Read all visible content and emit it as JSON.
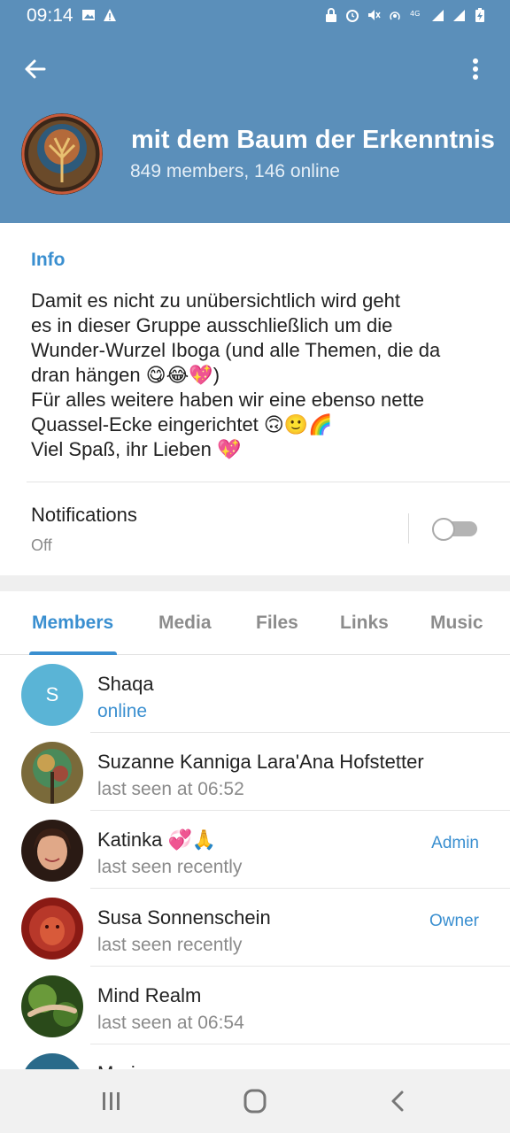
{
  "status_bar": {
    "time": "09:14",
    "left_icons": [
      "image-icon",
      "warning-icon"
    ],
    "right_icons": [
      "lock-icon",
      "alarm-icon",
      "mute-icon",
      "hotspot-icon",
      "4g-icon",
      "signal-icon",
      "signal-roaming-icon",
      "battery-charging-icon"
    ]
  },
  "header": {
    "title": "mit dem Baum der Erkenntnis",
    "subtitle": "849 members, 146 online",
    "back_icon": "arrow-left-icon",
    "menu_icon": "more-vertical-icon",
    "color": "#5b8fba"
  },
  "info": {
    "label": "Info",
    "text": "Damit es nicht zu unübersichtlich wird geht\nes in dieser Gruppe ausschließlich um die\nWunder-Wurzel Iboga (und alle Themen, die da\ndran hängen 😋😂💖)\nFür alles weitere haben wir eine ebenso nette\nQuassel-Ecke eingerichtet 🙃🙂🌈\nViel Spaß, ihr Lieben 💖"
  },
  "notifications": {
    "label": "Notifications",
    "value": "Off",
    "enabled": false
  },
  "tabs": [
    {
      "label": "Members",
      "active": true
    },
    {
      "label": "Media",
      "active": false
    },
    {
      "label": "Files",
      "active": false
    },
    {
      "label": "Links",
      "active": false
    },
    {
      "label": "Music",
      "active": false
    }
  ],
  "members": [
    {
      "name": "Shaqa",
      "status": "online",
      "role": "",
      "avatar_letter": "S",
      "avatar_color": "#5ab4d6"
    },
    {
      "name": "Suzanne Kanniga Lara'Ana Hofstetter",
      "status": "last seen at 06:52",
      "role": "",
      "avatar_letter": "",
      "avatar_color": "#8a7a4a"
    },
    {
      "name": "Katinka 💞🙏",
      "status": "last seen recently",
      "role": "Admin",
      "avatar_letter": "",
      "avatar_color": "#5a3a2a"
    },
    {
      "name": "Susa Sonnenschein",
      "status": "last seen recently",
      "role": "Owner",
      "avatar_letter": "",
      "avatar_color": "#b0382a"
    },
    {
      "name": "Mind Realm",
      "status": "last seen at 06:54",
      "role": "",
      "avatar_letter": "",
      "avatar_color": "#3f6b2a"
    },
    {
      "name": "Marie",
      "status": "",
      "role": "",
      "avatar_letter": "",
      "avatar_color": "#2a6a8a"
    }
  ],
  "accent_color": "#3a8fd0",
  "nav_bar": {
    "icons": [
      "recent-apps-icon",
      "home-icon",
      "back-icon"
    ]
  }
}
